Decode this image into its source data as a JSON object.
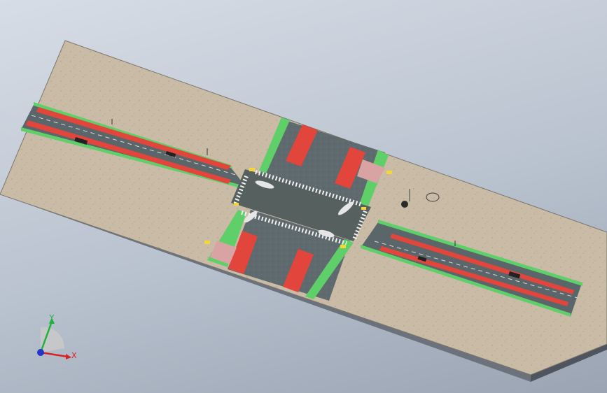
{
  "viewport": {
    "background_top": "#d7dde6",
    "background_bottom": "#9aa4b2"
  },
  "colors": {
    "ground": "#c9bba6",
    "slab_side": "#5d646e",
    "asphalt": "#5f6a6e",
    "asphalt_dark": "#4b5558",
    "bus_lane": "#e2453b",
    "median_green": "#5fcf6a",
    "line_white": "#f2f2f2",
    "line_yellow": "#f2d63a"
  },
  "triad": {
    "x_label": "X",
    "y_label": "Y",
    "x_color": "#d62424",
    "y_color": "#1fb23a",
    "z_color": "#2236c8",
    "x_icon": "arrow-x-axis-icon",
    "y_icon": "arrow-y-axis-icon",
    "z_icon": "origin-z-axis-icon"
  }
}
